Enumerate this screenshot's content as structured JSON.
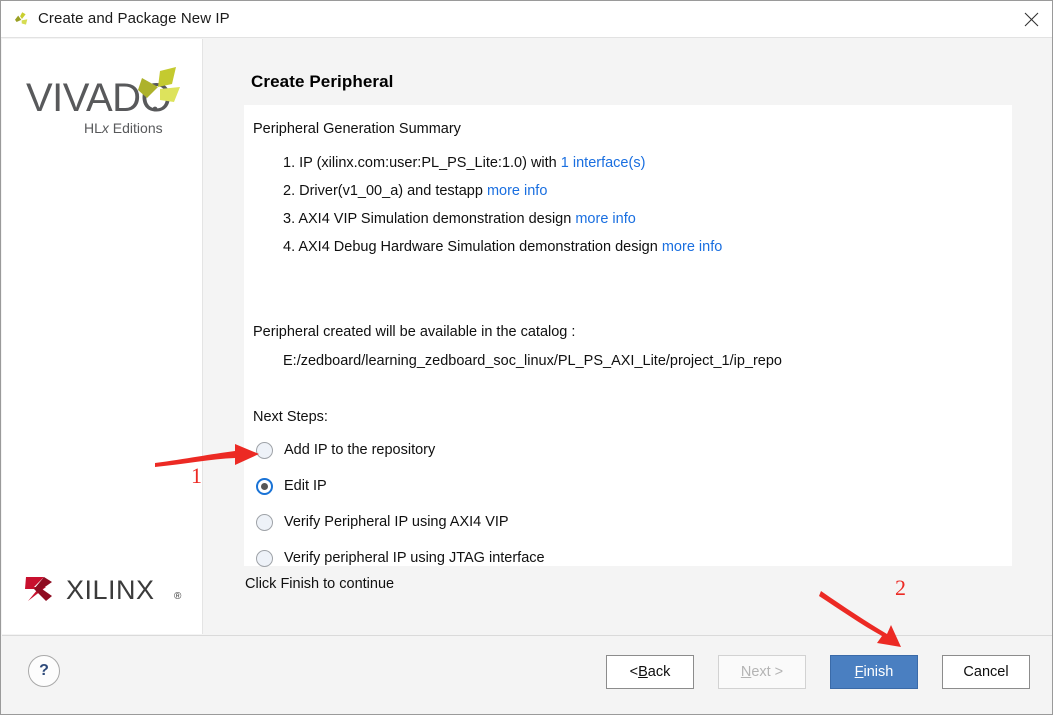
{
  "window": {
    "title": "Create and Package New IP",
    "app_icon": "vivado-pinwheel-icon",
    "close_icon": "close-icon"
  },
  "sidebar": {
    "vivado_logo": {
      "wordmark": "VIVADO",
      "subtitle": "HLx Editions"
    },
    "xilinx_logo": {
      "wordmark": "XILINX",
      "registered": "®"
    }
  },
  "main": {
    "page_title": "Create Peripheral",
    "summary_title": "Peripheral Generation Summary",
    "summary_items": [
      {
        "number": "1.",
        "text": "IP (xilinx.com:user:PL_PS_Lite:1.0) with ",
        "link": "1 interface(s)",
        "text_after": ""
      },
      {
        "number": "2.",
        "text": "Driver(v1_00_a) and testapp ",
        "link": "more info",
        "text_after": ""
      },
      {
        "number": "3.",
        "text": "AXI4 VIP Simulation demonstration design ",
        "link": "more info",
        "text_after": ""
      },
      {
        "number": "4.",
        "text": "AXI4 Debug Hardware Simulation demonstration design ",
        "link": "more info",
        "text_after": ""
      }
    ],
    "catalog_line": "Peripheral created will be available in the catalog :",
    "catalog_path": "E:/zedboard/learning_zedboard_soc_linux/PL_PS_AXI_Lite/project_1/ip_repo",
    "next_steps_label": "Next Steps:",
    "options": [
      {
        "label": "Add IP to the repository",
        "selected": false
      },
      {
        "label": "Edit IP",
        "selected": true
      },
      {
        "label": "Verify Peripheral IP using AXI4 VIP",
        "selected": false
      },
      {
        "label": "Verify peripheral IP using JTAG interface",
        "selected": false
      }
    ],
    "hint": "Click Finish to continue"
  },
  "footer": {
    "help_label": "?",
    "buttons": {
      "back": {
        "pre": "< ",
        "accel": "B",
        "post": "ack",
        "disabled": false
      },
      "next": {
        "pre": "",
        "accel": "N",
        "post": "ext >",
        "disabled": true
      },
      "finish": {
        "pre": "",
        "accel": "F",
        "post": "inish",
        "disabled": false,
        "primary": true
      },
      "cancel": {
        "pre": "",
        "accel": "",
        "post": "Cancel",
        "disabled": false
      }
    }
  },
  "annotations": {
    "arrow_1_number": "1",
    "arrow_2_number": "2",
    "color": "#ec2a24"
  },
  "colors": {
    "link": "#1a6fe0",
    "primary_button": "#4a7fc1",
    "radio_selected_ring": "#1a73d6",
    "annotation_red": "#ec2a24",
    "panel_bg": "#ffffff",
    "dialog_bg": "#f4f4f4"
  }
}
